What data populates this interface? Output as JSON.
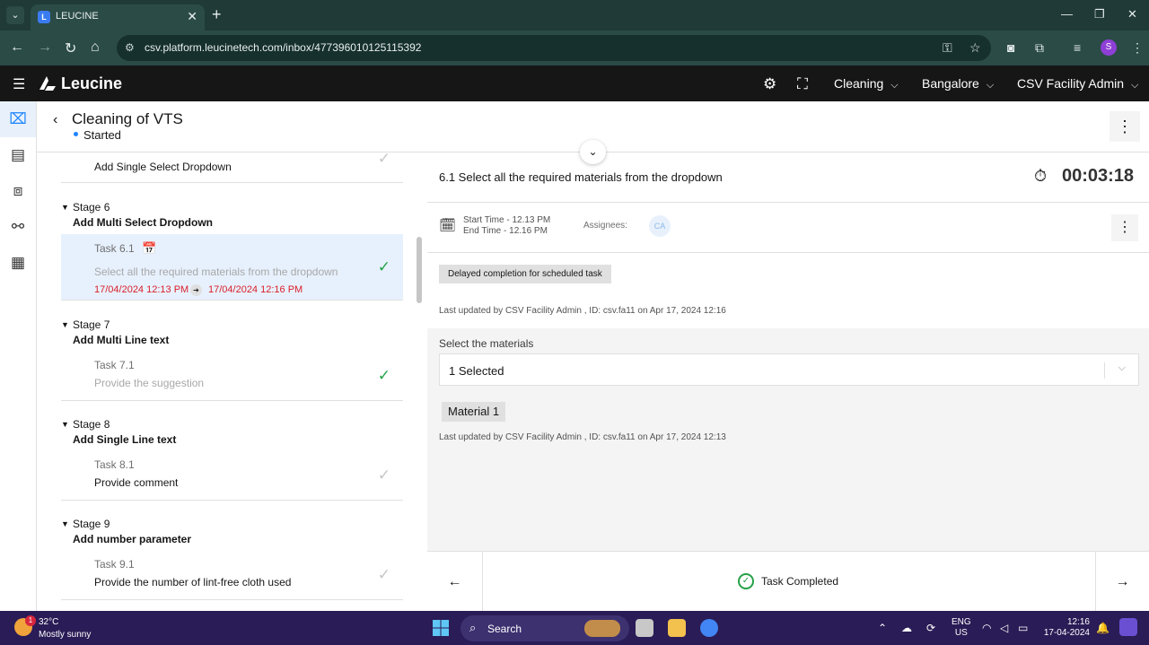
{
  "browser": {
    "tab_title": "LEUCINE",
    "url": "csv.platform.leucinetech.com/inbox/477396010125115392",
    "profile_initial": "S"
  },
  "header": {
    "logo_text": "Leucine",
    "use_case": "Cleaning",
    "facility": "Bangalore",
    "role": "CSV Facility Admin"
  },
  "page": {
    "title": "Cleaning of VTS",
    "status": "Started"
  },
  "stages": [
    {
      "stage_label": "",
      "stage_name": "",
      "tasks": [
        {
          "num": "",
          "text": "Add Single Select Dropdown",
          "check": "grey"
        }
      ]
    },
    {
      "stage_label": "Stage 6",
      "stage_name": "Add Multi Select Dropdown",
      "tasks": [
        {
          "num": "Task 6.1",
          "text": "Select all the required materials from the dropdown",
          "start": "17/04/2024 12:13 PM",
          "end": "17/04/2024 12:16 PM",
          "check": "green",
          "selected": true
        }
      ]
    },
    {
      "stage_label": "Stage 7",
      "stage_name": "Add Multi Line text",
      "tasks": [
        {
          "num": "Task 7.1",
          "text": "Provide the suggestion",
          "check": "green"
        }
      ]
    },
    {
      "stage_label": "Stage 8",
      "stage_name": "Add Single Line text",
      "tasks": [
        {
          "num": "Task 8.1",
          "text": "Provide comment",
          "check": "grey"
        }
      ]
    },
    {
      "stage_label": "Stage 9",
      "stage_name": "Add number parameter",
      "tasks": [
        {
          "num": "Task 9.1",
          "text": "Provide the number of lint-free cloth used",
          "check": "grey"
        }
      ]
    }
  ],
  "task": {
    "title": "6.1 Select all the required materials from the dropdown",
    "timer": "00:03:18",
    "start_time": "Start Time - 12.13 PM",
    "end_time": "End Time - 12.16 PM",
    "assignees_label": "Assignees:",
    "assignee_initials": "CA",
    "delay_tag": "Delayed completion for scheduled task",
    "last_updated_task": "Last updated by CSV Facility Admin , ID: csv.fa11 on Apr 17, 2024 12:16",
    "field_label": "Select the materials",
    "dropdown_value": "1 Selected",
    "selected_chip": "Material 1",
    "last_updated_field": "Last updated by CSV Facility Admin , ID: csv.fa11 on Apr 17, 2024 12:13",
    "completion_text": "Task Completed"
  },
  "taskbar": {
    "weather_badge": "1",
    "temperature": "32°C",
    "weather_desc": "Mostly sunny",
    "search_placeholder": "Search",
    "lang_line1": "ENG",
    "lang_line2": "US",
    "time": "12:16",
    "date": "17-04-2024"
  },
  "colors": {
    "accent": "#1d84ff",
    "success": "#24a148",
    "danger": "#da1e28",
    "header_bg": "#161616"
  }
}
